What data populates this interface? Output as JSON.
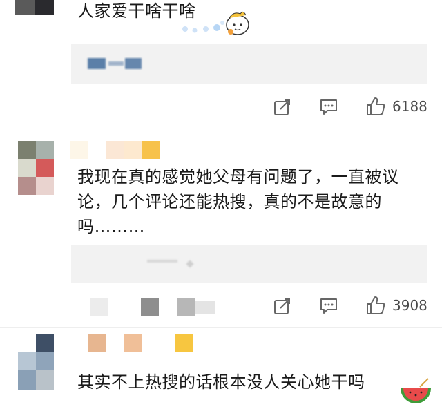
{
  "comments": [
    {
      "text": "人家爱干啥干啥",
      "likes": "6188",
      "has_sticker": true
    },
    {
      "text_lines": [
        "我现在真的感觉她父母有问题了，一直被议",
        "论，几个评论还能热搜，真的不是故意的",
        "吗………"
      ],
      "likes": "3908"
    },
    {
      "text": "其实不上热搜的话根本没人关心她干吗"
    }
  ],
  "icons": {
    "share": "share-icon",
    "comment": "comment-icon",
    "like": "thumbs-up-icon"
  },
  "colors": {
    "text": "#1a1a1a",
    "gray_box": "#f2f2f2",
    "icon": "#666666"
  }
}
